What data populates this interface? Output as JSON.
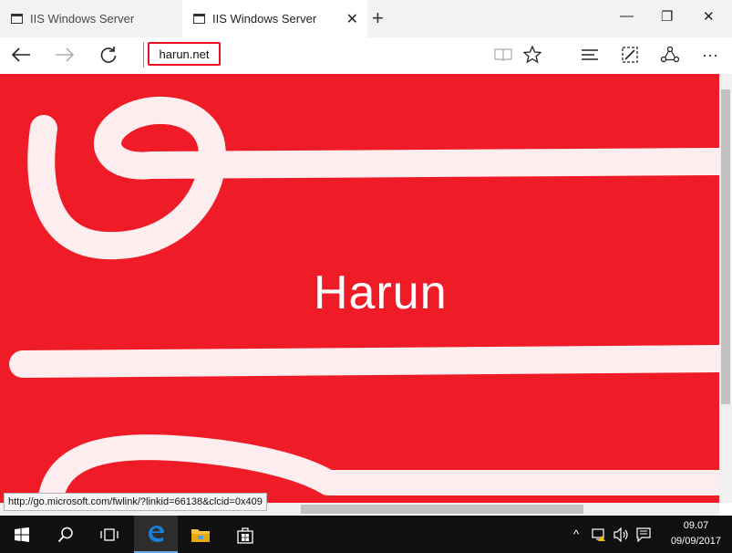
{
  "browser": {
    "tabs": [
      {
        "title": "IIS Windows Server",
        "active": false
      },
      {
        "title": "IIS Windows Server",
        "active": true
      }
    ],
    "address": "harun.net",
    "status_url": "http://go.microsoft.com/fwlink/?linkid=66138&clcid=0x409"
  },
  "page": {
    "heading": "Harun",
    "background_color": "#ef1c27"
  },
  "taskbar": {
    "time": "09.07",
    "date": "09/09/2017",
    "icons": [
      "start-icon",
      "search-icon",
      "task-view-icon",
      "edge-icon",
      "file-explorer-icon",
      "store-icon"
    ],
    "tray_icons": [
      "chevron-up-icon",
      "network-icon",
      "volume-icon",
      "action-center-icon"
    ]
  }
}
